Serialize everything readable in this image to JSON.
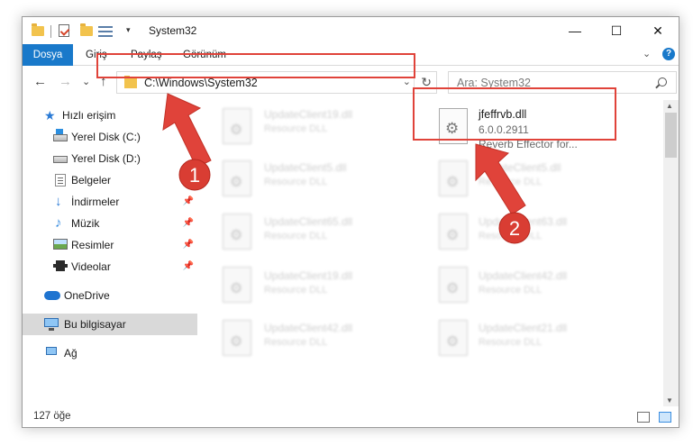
{
  "window": {
    "title": "System32",
    "controls": {
      "minimize": "—",
      "maximize": "☐",
      "close": "✕"
    }
  },
  "ribbon": {
    "tabs": [
      "Dosya",
      "Giriş",
      "Paylaş",
      "Görünüm"
    ],
    "expand": "⌄",
    "help": "?"
  },
  "address": {
    "path": "C:\\Windows\\System32",
    "dropdown": "⌄",
    "refresh": "↻"
  },
  "search": {
    "placeholder": "Ara: System32"
  },
  "nav": {
    "back": "←",
    "forward": "→",
    "recent": "⌄",
    "up": "↑"
  },
  "sidebar": {
    "items": [
      {
        "label": "Hızlı erişim",
        "icon": "star-icon"
      },
      {
        "label": "Yerel Disk (C:)",
        "icon": "drive-c-icon"
      },
      {
        "label": "Yerel Disk (D:)",
        "icon": "drive-d-icon"
      },
      {
        "label": "Belgeler",
        "icon": "documents-icon"
      },
      {
        "label": "İndirmeler",
        "icon": "downloads-icon"
      },
      {
        "label": "Müzik",
        "icon": "music-icon"
      },
      {
        "label": "Resimler",
        "icon": "pictures-icon"
      },
      {
        "label": "Videolar",
        "icon": "videos-icon"
      },
      {
        "label": "OneDrive",
        "icon": "cloud-icon"
      },
      {
        "label": "Bu bilgisayar",
        "icon": "pc-icon",
        "selected": true
      },
      {
        "label": "Ağ",
        "icon": "network-icon"
      }
    ],
    "pin": "📌"
  },
  "files": {
    "left": [
      {
        "name": "UpdateClient19.dll",
        "desc": "Resource DLL"
      },
      {
        "name": "UpdateClient5.dll",
        "desc": "Resource DLL"
      },
      {
        "name": "UpdateClient65.dll",
        "desc": "Resource DLL"
      },
      {
        "name": "UpdateClient19.dll",
        "desc": "Resource DLL"
      },
      {
        "name": "UpdateClient42.dll",
        "desc": "Resource DLL"
      }
    ],
    "right": [
      {
        "name": "UpdateClient5.dll",
        "desc": "Resource DLL"
      },
      {
        "name": "UpdateClient63.dll",
        "desc": "Resource DLL"
      },
      {
        "name": "UpdateClient42.dll",
        "desc": "Resource DLL"
      },
      {
        "name": "UpdateClient21.dll",
        "desc": "Resource DLL"
      }
    ],
    "featured": {
      "name": "jfeffrvb.dll",
      "version": "6.0.0.2911",
      "description": "Reverb Effector for..."
    }
  },
  "status": {
    "count": "127 öğe"
  },
  "annotations": {
    "step1": "1",
    "step2": "2",
    "color": "#e0433a"
  }
}
